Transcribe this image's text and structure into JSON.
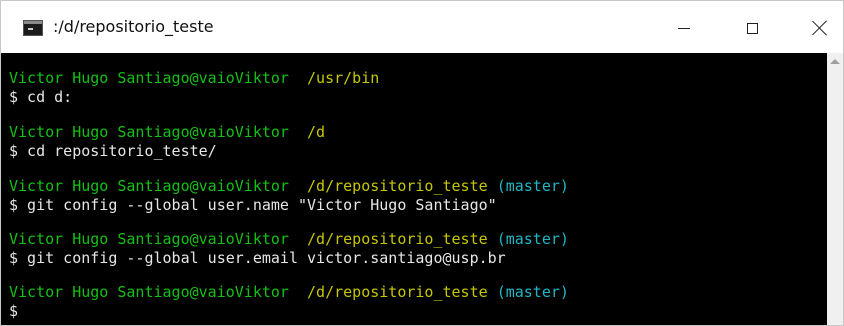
{
  "window": {
    "title": ":/d/repositorio_teste",
    "icon": "terminal-icon"
  },
  "controls": {
    "minimize": "minimize-icon",
    "maximize": "maximize-icon",
    "close": "close-icon"
  },
  "terminal": {
    "colors": {
      "user": "#13c013",
      "path": "#c6c600",
      "branch": "#21b6c6",
      "text": "#e6e6e6"
    },
    "blocks": [
      {
        "user": "Victor Hugo Santiago@vaioViktor",
        "path": "/usr/bin",
        "branch": "",
        "command": "$ cd d:"
      },
      {
        "user": "Victor Hugo Santiago@vaioViktor",
        "path": "/d",
        "branch": "",
        "command": "$ cd repositorio_teste/"
      },
      {
        "user": "Victor Hugo Santiago@vaioViktor",
        "path": "/d/repositorio_teste",
        "branch": "(master)",
        "command": "$ git config --global user.name \"Victor Hugo Santiago\""
      },
      {
        "user": "Victor Hugo Santiago@vaioViktor",
        "path": "/d/repositorio_teste",
        "branch": "(master)",
        "command": "$ git config --global user.email victor.santiago@usp.br"
      },
      {
        "user": "Victor Hugo Santiago@vaioViktor",
        "path": "/d/repositorio_teste",
        "branch": "(master)",
        "command": "$"
      }
    ]
  }
}
